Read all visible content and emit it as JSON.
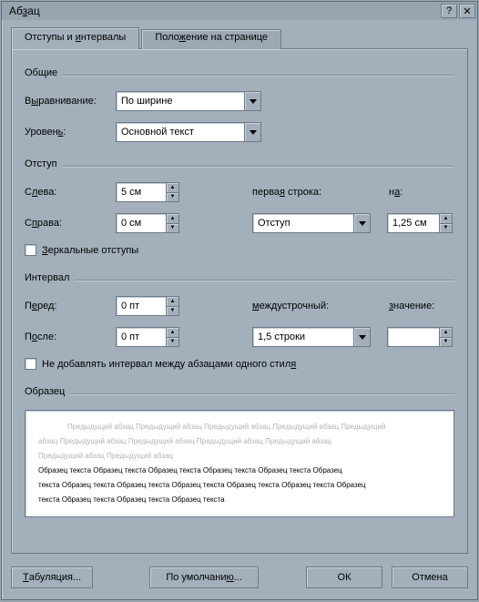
{
  "window": {
    "title_pre": "Аб",
    "title_und": "з",
    "title_post": "ац"
  },
  "tabs": {
    "active_pre": "Отступы и ",
    "active_und": "и",
    "active_post": "нтервалы",
    "inactive_pre": "Поло",
    "inactive_und": "ж",
    "inactive_post": "ение на странице"
  },
  "groups": {
    "general": "Общие",
    "indent": "Отступ",
    "interval": "Интервал",
    "sample": "Образец"
  },
  "labels": {
    "align_pre": "В",
    "align_und": "ы",
    "align_post": "равнивание:",
    "level_pre": "Уровен",
    "level_und": "ь",
    "level_post": ":",
    "left_pre": "С",
    "left_und": "л",
    "left_post": "ева:",
    "right_pre": "С",
    "right_und": "п",
    "right_post": "рава:",
    "firstline_pre": "перва",
    "firstline_und": "я",
    "firstline_post": " строка:",
    "by1_pre": "н",
    "by1_und": "а",
    "by1_post": ":",
    "mirror_pre": "",
    "mirror_und": "З",
    "mirror_post": "еркальные отступы",
    "before_pre": "П",
    "before_und": "е",
    "before_post": "ред:",
    "after_pre": "П",
    "after_und": "о",
    "after_post": "сле:",
    "linespace_pre": "",
    "linespace_und": "м",
    "linespace_post": "еждустрочный:",
    "value_pre": "",
    "value_und": "з",
    "value_post": "начение:",
    "nosame_pre": "Не добавлять интервал между абзацами одного стил",
    "nosame_und": "я",
    "nosame_post": ""
  },
  "values": {
    "align": "По ширине",
    "level": "Основной текст",
    "left": "5 см",
    "right": "0 см",
    "firstline": "Отступ",
    "by1": "1,25 см",
    "before": "0 пт",
    "after": "0 пт",
    "linespace": "1,5 строки",
    "value": ""
  },
  "preview": {
    "faded1": "Предыдущий абзац Предыдущий абзац Предыдущий абзац Предыдущий абзац Предыдущий",
    "faded2": "абзац Предыдущий абзац Предыдущий абзац Предыдущий абзац Предыдущий абзац",
    "faded3": "Предыдущий абзац Предыдущий абзац",
    "strong1": "Образец текста Образец текста Образец текста Образец текста Образец текста Образец",
    "strong2": "текста Образец текста Образец текста Образец текста Образец текста Образец текста Образец",
    "strong3": "текста Образец текста Образец текста Образец текста"
  },
  "buttons": {
    "tabs_pre": "",
    "tabs_und": "Т",
    "tabs_post": "абуляция...",
    "default_pre": "По умолчани",
    "default_und": "ю",
    "default_post": "...",
    "ok": "ОК",
    "cancel": "Отмена"
  }
}
